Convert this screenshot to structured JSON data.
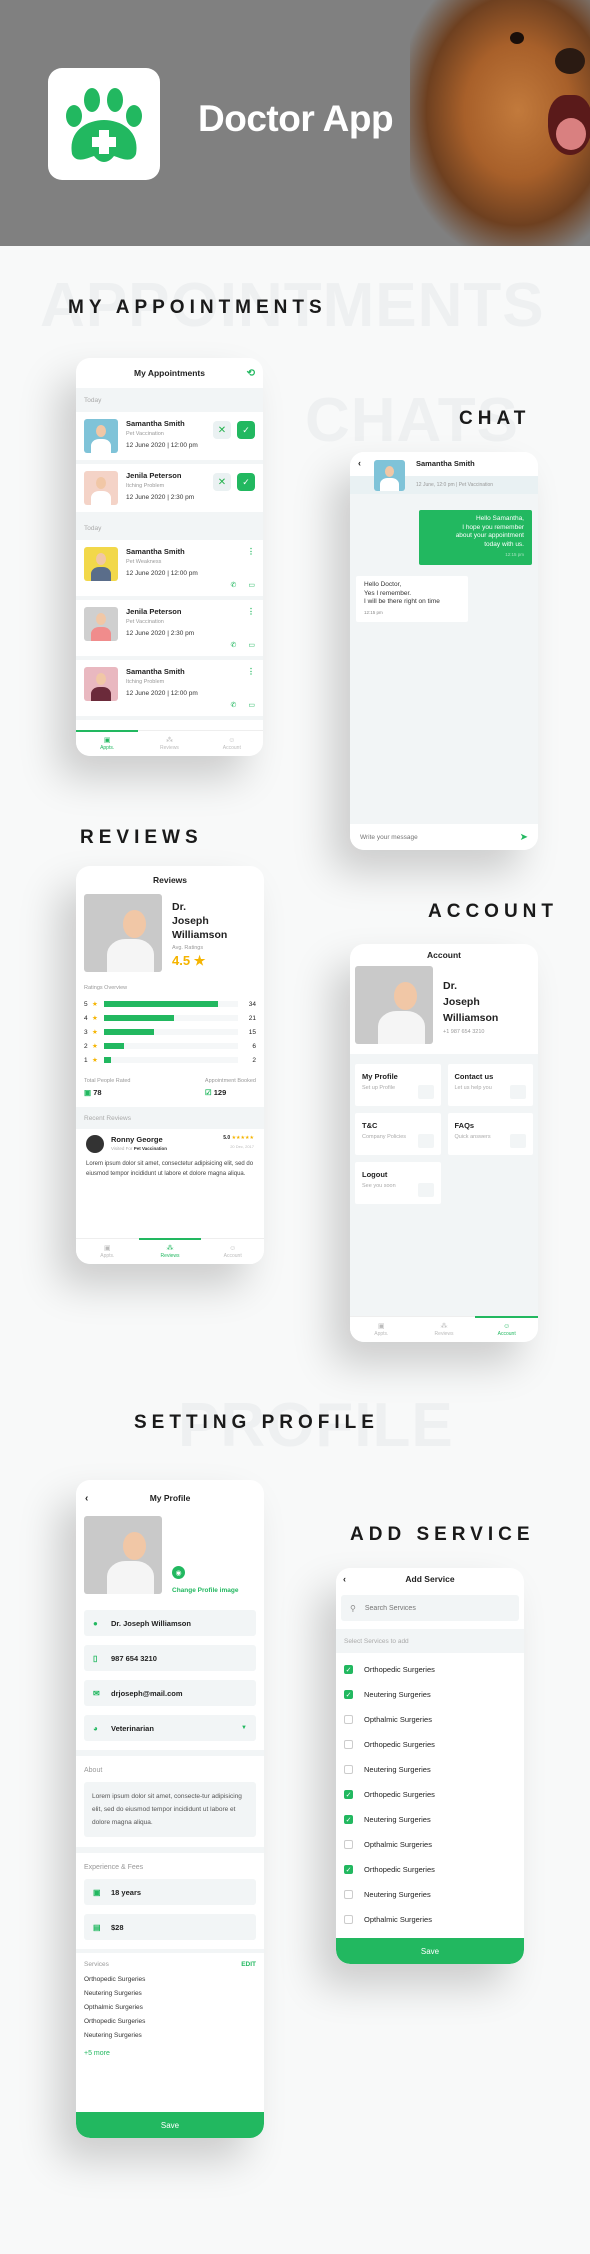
{
  "hero": {
    "title": "Doctor App",
    "logo_icon": "paw-medical-cross-icon"
  },
  "sections": {
    "appointments": {
      "title": "MY APPOINTMENTS",
      "watermark": "APPOINTMENTS"
    },
    "chat": {
      "title": "CHAT",
      "watermark": "CHATS"
    },
    "reviews": {
      "title": "REVIEWS"
    },
    "account": {
      "title": "ACCOUNT"
    },
    "profile": {
      "title": "SETTING PROFILE",
      "watermark": "PROFILE"
    },
    "add_service": {
      "title": "ADD SERVICE"
    }
  },
  "appointments_screen": {
    "header": "My Appointments",
    "history_icon": "history-icon",
    "group1_label": "Today",
    "pending": [
      {
        "name": "Samantha Smith",
        "reason": "Pet Vaccination",
        "when": "12 June 2020 | 12:00 pm"
      },
      {
        "name": "Jenila Peterson",
        "reason": "Itching Problem",
        "when": "12 June 2020 | 2:30 pm"
      }
    ],
    "group2_label": "Today",
    "confirmed": [
      {
        "name": "Samantha Smith",
        "reason": "Pet Weakness",
        "when": "12 June 2020 | 12:00 pm"
      },
      {
        "name": "Jenila Peterson",
        "reason": "Pet Vaccination",
        "when": "12 June 2020 | 2:30 pm"
      },
      {
        "name": "Samantha Smith",
        "reason": "Itching Problem",
        "when": "12 June 2020 | 12:00 pm"
      }
    ]
  },
  "tabs": {
    "appts": "Appts.",
    "reviews": "Reviews",
    "account": "Account"
  },
  "chat_screen": {
    "contact_name": "Samantha Smith",
    "meta": "12 June,  12:0 pm   |   Pet Vaccination",
    "messages": [
      {
        "from": "doctor",
        "text_lines": [
          "Hello Samantha,",
          "I hope you remember",
          "about your appointment",
          "today with us."
        ],
        "time": "12:15 pm"
      },
      {
        "from": "patient",
        "text_lines": [
          "Hello  Doctor,",
          "Yes I remember.",
          "I will be there right  on time"
        ],
        "time": "12:15 pm"
      }
    ],
    "input_placeholder": "Write your message"
  },
  "reviews_screen": {
    "header": "Reviews",
    "doctor_name_lines": [
      "Dr.",
      "Joseph",
      "Williamson"
    ],
    "avg_label": "Avg. Ratings",
    "avg_value": "4.5",
    "overview_label": "Ratings Overview",
    "ratings": [
      {
        "stars": "5",
        "count": 34
      },
      {
        "stars": "4",
        "count": 21
      },
      {
        "stars": "3",
        "count": 15
      },
      {
        "stars": "2",
        "count": 6
      },
      {
        "stars": "1",
        "count": 2
      }
    ],
    "total_label": "Total People Rated",
    "total_value": "78",
    "booked_label": "Appointment Booked",
    "booked_value": "129",
    "recent_label": "Recent Reviews",
    "review": {
      "name": "Ronny George",
      "visited_prefix": "Visited For",
      "visited_for": "Pet Vaccination",
      "score": "5.0",
      "stars": "★★★★★",
      "date": "20 Dec, 2017",
      "text": "Lorem ipsum dolor sit amet, consectetur adipisicing elit, sed do eiusmod tempor incididunt ut labore et dolore magna aliqua."
    }
  },
  "account_screen": {
    "header": "Account",
    "doctor_name_lines": [
      "Dr.",
      "Joseph",
      "Williamson"
    ],
    "phone": "+1 987 654 3210",
    "tiles": [
      {
        "title": "My Profile",
        "subtitle": "Set up Profile",
        "icon": "wallet-icon"
      },
      {
        "title": "Contact us",
        "subtitle": "Let us help you",
        "icon": "mail-icon"
      },
      {
        "title": "T&C",
        "subtitle": "Company Policies",
        "icon": "clipboard-icon"
      },
      {
        "title": "FAQs",
        "subtitle": "Quick answers",
        "icon": "info-icon"
      },
      {
        "title": "Logout",
        "subtitle": "See you soon",
        "icon": "exit-icon"
      }
    ]
  },
  "profile_screen": {
    "header": "My Profile",
    "change_image": "Change Profile image",
    "fields": {
      "name": "Dr. Joseph Williamson",
      "phone": "987 654 3210",
      "email": "drjoseph@mail.com",
      "role": "Veterinarian"
    },
    "about_label": "About",
    "about_text": "Lorem ipsum dolor sit amet, consecte-tur adipisicing elit, sed do eiusmod tempor incididunt ut labore et dolore magna aliqua.",
    "exp_label": "Experience & Fees",
    "experience": "18 years",
    "fee": "$28",
    "services_label": "Services",
    "edit_label": "EDIT",
    "services": [
      "Orthopedic Surgeries",
      "Neutering Surgeries",
      "Opthalmic Surgeries",
      "Orthopedic Surgeries",
      "Neutering Surgeries"
    ],
    "more": "+5 more",
    "save": "Save"
  },
  "add_service_screen": {
    "header": "Add Service",
    "search_placeholder": "Search Services",
    "select_label": "Select Services to add",
    "items": [
      {
        "label": "Orthopedic Surgeries",
        "checked": true
      },
      {
        "label": "Neutering Surgeries",
        "checked": true
      },
      {
        "label": "Opthalmic Surgeries",
        "checked": false
      },
      {
        "label": "Orthopedic Surgeries",
        "checked": false
      },
      {
        "label": "Neutering Surgeries",
        "checked": false
      },
      {
        "label": "Orthopedic Surgeries",
        "checked": true
      },
      {
        "label": "Neutering Surgeries",
        "checked": true
      },
      {
        "label": "Opthalmic Surgeries",
        "checked": false
      },
      {
        "label": "Orthopedic Surgeries",
        "checked": true
      },
      {
        "label": "Neutering Surgeries",
        "checked": false
      },
      {
        "label": "Opthalmic Surgeries",
        "checked": false
      }
    ],
    "save": "Save"
  },
  "colors": {
    "accent": "#22b860",
    "star": "#f5b400",
    "surface": "#f2f5f6",
    "hero_bg": "#808080"
  }
}
